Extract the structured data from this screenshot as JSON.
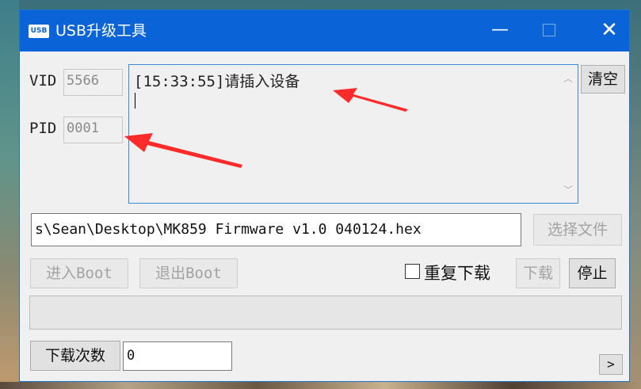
{
  "window": {
    "title": "USB升级工具",
    "icon_text": "USB",
    "controls": {
      "minimize": "—",
      "close": "✕"
    }
  },
  "device": {
    "vid_label": "VID",
    "vid_value": "5566",
    "pid_label": "PID",
    "pid_value": "0001"
  },
  "log": {
    "text": "[15:33:55]请插入设备"
  },
  "buttons": {
    "clear": "清空",
    "choose_file": "选择文件",
    "enter_boot": "进入Boot",
    "exit_boot": "退出Boot",
    "download": "下载",
    "stop": "停止",
    "download_count": "下载次数",
    "more": ">"
  },
  "file": {
    "path": "s\\Sean\\Desktop\\MK859 Firmware v1.0 040124.hex"
  },
  "options": {
    "repeat_download_label": "重复下载",
    "repeat_download_checked": false
  },
  "progress": {
    "value": 0
  },
  "counter": {
    "value": "0"
  },
  "colors": {
    "titlebar": "#0a64d8",
    "log_border": "#3a8bdc",
    "annotation_arrow": "#ff2b2b"
  }
}
